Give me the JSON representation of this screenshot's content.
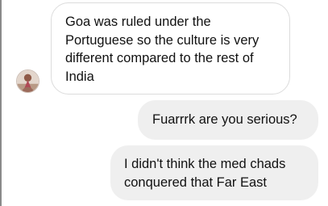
{
  "conversation": {
    "messages": [
      {
        "direction": "incoming",
        "lines": [
          "Goa was ruled under the",
          "Portuguese so the culture is very",
          "different compared to the rest of",
          "India"
        ]
      },
      {
        "direction": "outgoing",
        "lines": [
          "Fuarrrk are you serious?"
        ]
      },
      {
        "direction": "outgoing",
        "lines": [
          "I didn't think the med chads",
          "conquered that Far East"
        ]
      }
    ]
  },
  "avatar": {
    "icon": "profile-photo-icon"
  },
  "colors": {
    "incoming_bubble_bg": "#ffffff",
    "incoming_bubble_border": "#dcdcdc",
    "outgoing_bubble_bg": "#efefef",
    "text": "#111111"
  }
}
